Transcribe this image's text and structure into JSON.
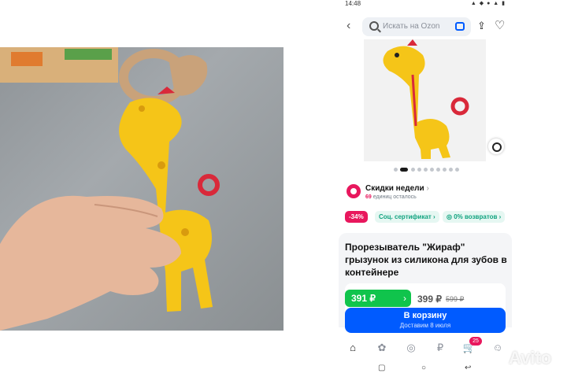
{
  "status": {
    "time": "14:48",
    "icons": "▲ ◆ ● ▲ ▮"
  },
  "search": {
    "placeholder": "Искать на Ozon"
  },
  "promo": {
    "title": "Скидки недели",
    "chevron": "›",
    "count": "69",
    "remaining": "единиц осталось"
  },
  "tags": {
    "discount": "-34%",
    "certificate": "Соц. сертификат ›",
    "returns": "◎ 0% возвратов ›"
  },
  "product": {
    "title": "Прорезыватель \"Жираф\" грызунок из силикона для зубов в контейнере"
  },
  "price": {
    "current": "391 ₽",
    "was": "399 ₽",
    "original": "599 ₽",
    "chevron": "›"
  },
  "cart": {
    "label": "В корзину",
    "delivery": "Доставим 8 июля"
  },
  "tabbar": {
    "cart_count": "25"
  },
  "watermark": {
    "text": "Avito"
  },
  "colors": {
    "ozon_blue": "#005bff",
    "promo_pink": "#e8175d",
    "price_green": "#10c44c",
    "giraffe_yellow": "#f5c518",
    "ring_red": "#d9293a"
  },
  "gallery": {
    "active_index": 1,
    "count": 10
  }
}
